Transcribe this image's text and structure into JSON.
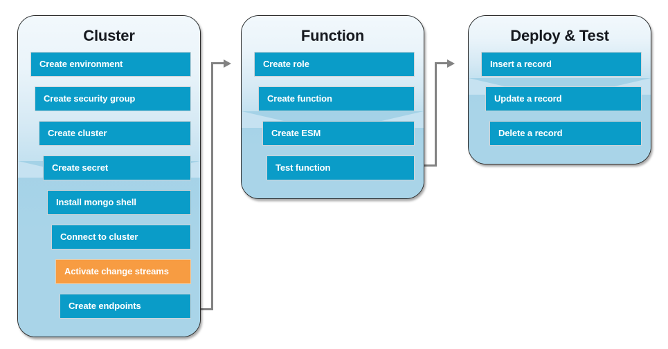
{
  "diagram": {
    "title_visible": false,
    "colors": {
      "step_blue": "#0A9CC8",
      "step_highlight_orange": "#F79C42",
      "panel_light": "#EAF4FA",
      "panel_blue": "#A9D4E8",
      "connector_gray": "#828282",
      "title_text": "#16191F",
      "step_text": "#FFFFFF"
    },
    "columns": [
      {
        "id": "cluster",
        "title": "Cluster",
        "steps": [
          {
            "label": "Create environment",
            "highlight": false
          },
          {
            "label": "Create security group",
            "highlight": false
          },
          {
            "label": "Create cluster",
            "highlight": false
          },
          {
            "label": "Create secret",
            "highlight": false
          },
          {
            "label": "Install mongo shell",
            "highlight": false
          },
          {
            "label": "Connect to cluster",
            "highlight": false
          },
          {
            "label": "Activate change streams",
            "highlight": true
          },
          {
            "label": "Create endpoints",
            "highlight": false
          }
        ]
      },
      {
        "id": "function",
        "title": "Function",
        "steps": [
          {
            "label": "Create role",
            "highlight": false
          },
          {
            "label": "Create function",
            "highlight": false
          },
          {
            "label": "Create ESM",
            "highlight": false
          },
          {
            "label": "Test function",
            "highlight": false
          }
        ]
      },
      {
        "id": "deploy-test",
        "title": "Deploy & Test",
        "steps": [
          {
            "label": "Insert a record",
            "highlight": false
          },
          {
            "label": "Update a record",
            "highlight": false
          },
          {
            "label": "Delete a record",
            "highlight": false
          }
        ]
      }
    ],
    "connectors": [
      {
        "from": "cluster",
        "to": "function",
        "style": "elbow-up-right"
      },
      {
        "from": "function",
        "to": "deploy-test",
        "style": "elbow-up-right"
      }
    ]
  }
}
